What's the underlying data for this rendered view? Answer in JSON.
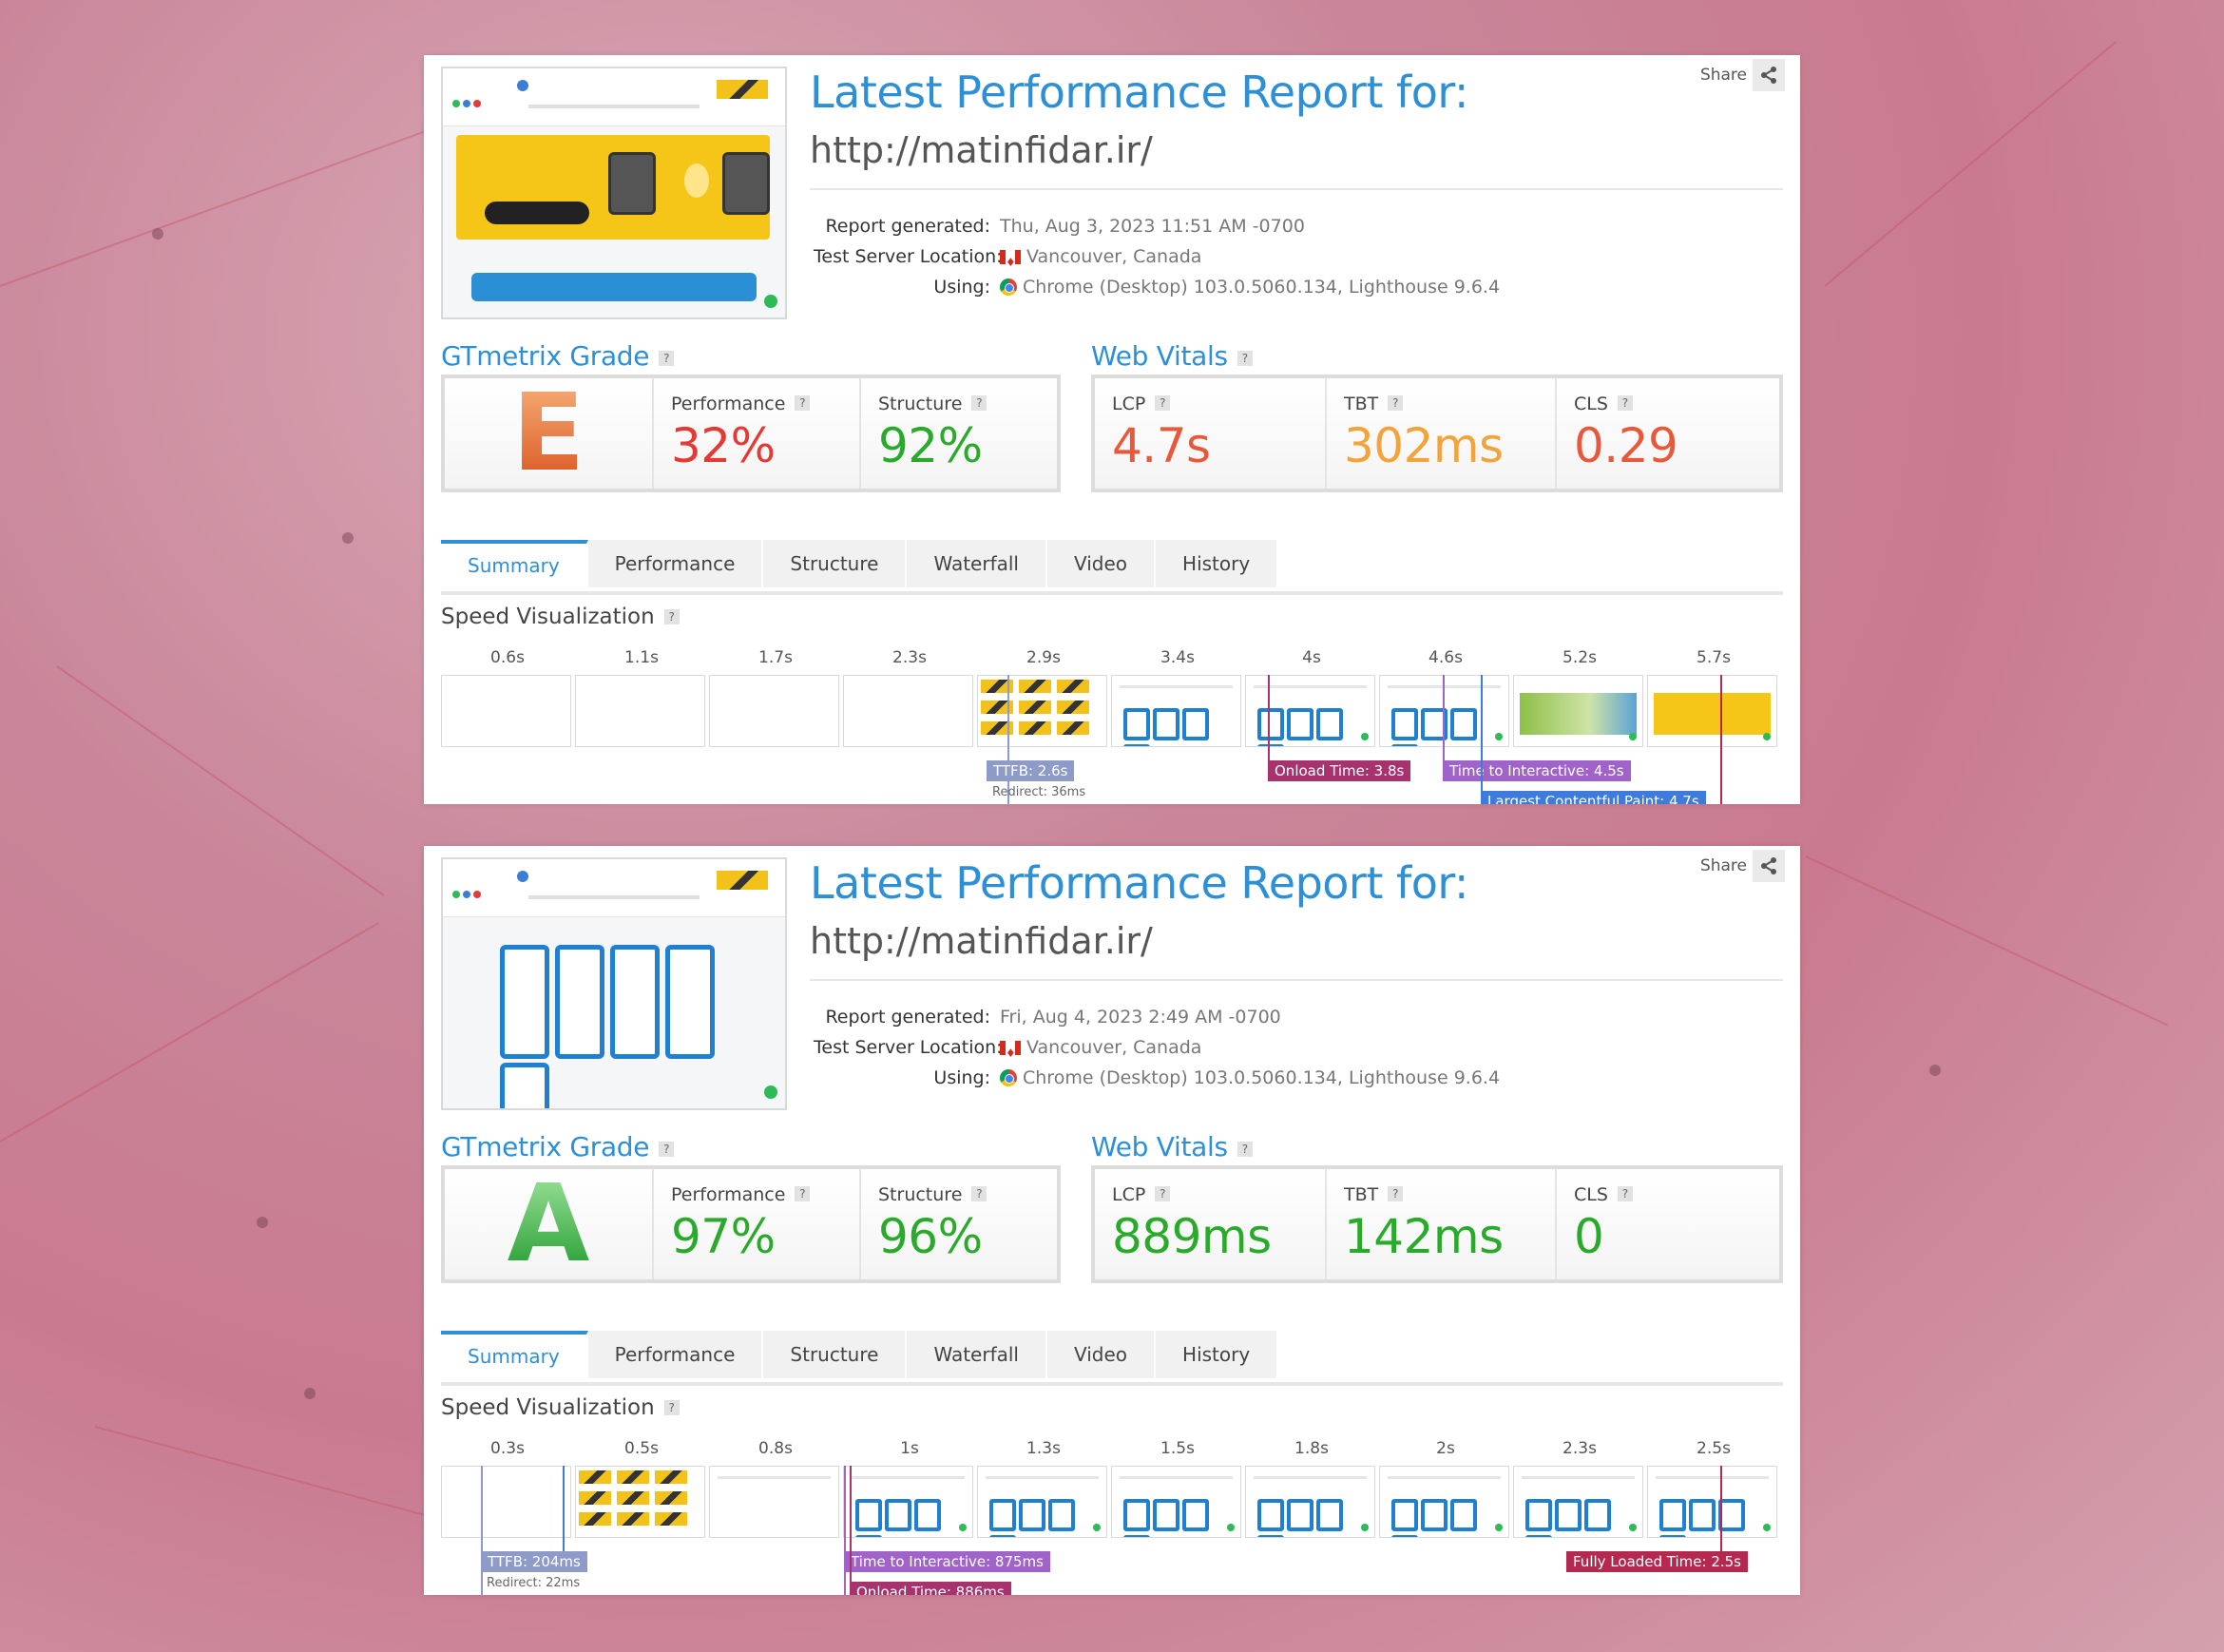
{
  "theme": {
    "accent": "#2d8fd6",
    "grade_e": "#e8642c",
    "grade_a": "#31a83a",
    "red": "#e53935",
    "orange": "#f2a33a",
    "green": "#2aaa2a",
    "ttfb": "#8e9ac8",
    "onload": "#a8326e",
    "tti": "#a063c9",
    "lcp": "#3d7bdc",
    "fully": "#b5284f"
  },
  "reports": [
    {
      "title": "Latest Performance Report for:",
      "url": "http://matinfidar.ir/",
      "share": "Share",
      "meta": {
        "generated_label": "Report generated:",
        "generated_value": "Thu, Aug 3, 2023 11:51 AM -0700",
        "location_label": "Test Server Location:",
        "location_value": "Vancouver, Canada",
        "using_label": "Using:",
        "using_value": "Chrome (Desktop) 103.0.5060.134, Lighthouse 9.6.4"
      },
      "grade_title": "GTmetrix Grade",
      "grade": "E",
      "performance_label": "Performance",
      "performance_value": "32%",
      "structure_label": "Structure",
      "structure_value": "92%",
      "vitals_title": "Web Vitals",
      "lcp_label": "LCP",
      "lcp_value": "4.7s",
      "tbt_label": "TBT",
      "tbt_value": "302ms",
      "cls_label": "CLS",
      "cls_value": "0.29",
      "tabs": [
        "Summary",
        "Performance",
        "Structure",
        "Waterfall",
        "Video",
        "History"
      ],
      "speed_title": "Speed Visualization",
      "ticks": [
        "0.6s",
        "1.1s",
        "1.7s",
        "2.3s",
        "2.9s",
        "3.4s",
        "4s",
        "4.6s",
        "5.2s",
        "5.7s"
      ],
      "markers": {
        "ttfb": "TTFB: 2.6s",
        "redirect": "Redirect: 36ms",
        "onload": "Onload Time: 3.8s",
        "tti": "Time to Interactive: 4.5s",
        "lcp": "Largest Contentful Paint: 4.7s"
      }
    },
    {
      "title": "Latest Performance Report for:",
      "url": "http://matinfidar.ir/",
      "share": "Share",
      "meta": {
        "generated_label": "Report generated:",
        "generated_value": "Fri, Aug 4, 2023 2:49 AM -0700",
        "location_label": "Test Server Location:",
        "location_value": "Vancouver, Canada",
        "using_label": "Using:",
        "using_value": "Chrome (Desktop) 103.0.5060.134, Lighthouse 9.6.4"
      },
      "grade_title": "GTmetrix Grade",
      "grade": "A",
      "performance_label": "Performance",
      "performance_value": "97%",
      "structure_label": "Structure",
      "structure_value": "96%",
      "vitals_title": "Web Vitals",
      "lcp_label": "LCP",
      "lcp_value": "889ms",
      "tbt_label": "TBT",
      "tbt_value": "142ms",
      "cls_label": "CLS",
      "cls_value": "0",
      "tabs": [
        "Summary",
        "Performance",
        "Structure",
        "Waterfall",
        "Video",
        "History"
      ],
      "speed_title": "Speed Visualization",
      "ticks": [
        "0.3s",
        "0.5s",
        "0.8s",
        "1s",
        "1.3s",
        "1.5s",
        "1.8s",
        "2s",
        "2.3s",
        "2.5s"
      ],
      "markers": {
        "ttfb": "TTFB: 204ms",
        "redirect": "Redirect: 22ms",
        "tti": "Time to Interactive: 875ms",
        "onload": "Onload Time: 886ms",
        "fully": "Fully Loaded Time: 2.5s"
      }
    }
  ]
}
